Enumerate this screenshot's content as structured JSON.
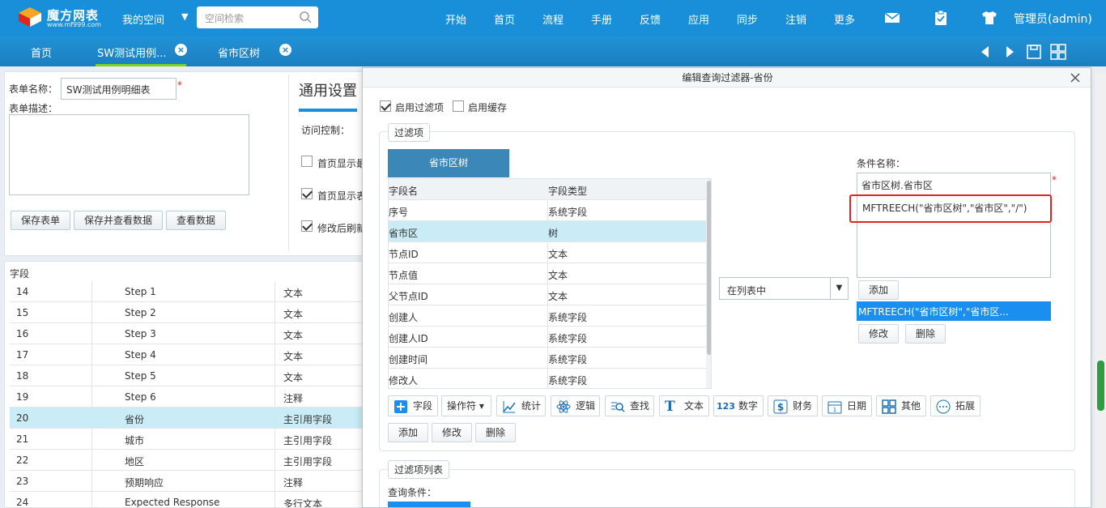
{
  "topbar": {
    "logo_title": "魔方网表",
    "logo_sub": "www.mf999.com",
    "my_space": "我的空间",
    "search_placeholder": "空间检索",
    "nav": [
      "开始",
      "首页",
      "流程",
      "手册",
      "反馈",
      "应用",
      "同步",
      "注销",
      "更多"
    ],
    "admin": "管理员(admin)"
  },
  "tabs": [
    {
      "label": "首页"
    },
    {
      "label": "SW测试用例..."
    },
    {
      "label": "省市区树"
    }
  ],
  "form": {
    "name_label": "表单名称：",
    "name_value": "SW测试用例明细表",
    "required_mark": "*",
    "desc_label": "表单描述：",
    "buttons": [
      "保存表单",
      "保存并查看数据",
      "查看数据"
    ],
    "section_title": "通用设置",
    "access_label": "访问控制：",
    "options": [
      "首页显示最",
      "首页显示表",
      "修改后刷新"
    ]
  },
  "grid": {
    "header": "字段",
    "rows": [
      {
        "n": "14",
        "name": "Step 1",
        "type": "文本"
      },
      {
        "n": "15",
        "name": "Step 2",
        "type": "文本"
      },
      {
        "n": "16",
        "name": "Step 3",
        "type": "文本"
      },
      {
        "n": "17",
        "name": "Step 4",
        "type": "文本"
      },
      {
        "n": "18",
        "name": "Step 5",
        "type": "文本"
      },
      {
        "n": "19",
        "name": "Step 6",
        "type": "注释"
      },
      {
        "n": "20",
        "name": "省份",
        "type": "主引用字段"
      },
      {
        "n": "21",
        "name": "城市",
        "type": "主引用字段"
      },
      {
        "n": "22",
        "name": "地区",
        "type": "主引用字段"
      },
      {
        "n": "23",
        "name": "预期响应",
        "type": "注释"
      },
      {
        "n": "24",
        "name": "Expected Response",
        "type": "多行文本"
      }
    ]
  },
  "dialog": {
    "title": "编辑查询过滤器-省份",
    "enable_filter": "启用过滤项",
    "enable_cache": "启用缓存",
    "legend_filter": "过滤项",
    "tree_tab": "省市区树",
    "col_field": "字段名",
    "col_type": "字段类型",
    "fields": [
      {
        "name": "序号",
        "type": "系统字段"
      },
      {
        "name": "省市区",
        "type": "树"
      },
      {
        "name": "节点ID",
        "type": "文本"
      },
      {
        "name": "节点值",
        "type": "文本"
      },
      {
        "name": "父节点ID",
        "type": "文本"
      },
      {
        "name": "创建人",
        "type": "系统字段"
      },
      {
        "name": "创建人ID",
        "type": "系统字段"
      },
      {
        "name": "创建时间",
        "type": "系统字段"
      },
      {
        "name": "修改人",
        "type": "系统字段"
      }
    ],
    "operator_select": "在列表中",
    "cond_name_label": "条件名称：",
    "cond_name_value": "省市区树.省市区",
    "expression": "MFTREECH(\"省市区树\",\"省市区\",\"/\")",
    "add_label": "添加",
    "cond_selected": "MFTREECH(\"省市区树\",\"省市区...",
    "modify_label": "修改",
    "delete_label": "删除",
    "toolbar": [
      "字段",
      "操作符",
      "统计",
      "逻辑",
      "查找",
      "文本",
      "数字",
      "财务",
      "日期",
      "其他",
      "拓展"
    ],
    "actions": [
      "添加",
      "修改",
      "删除"
    ],
    "legend_list": "过滤项列表",
    "query_label": "查询条件："
  }
}
